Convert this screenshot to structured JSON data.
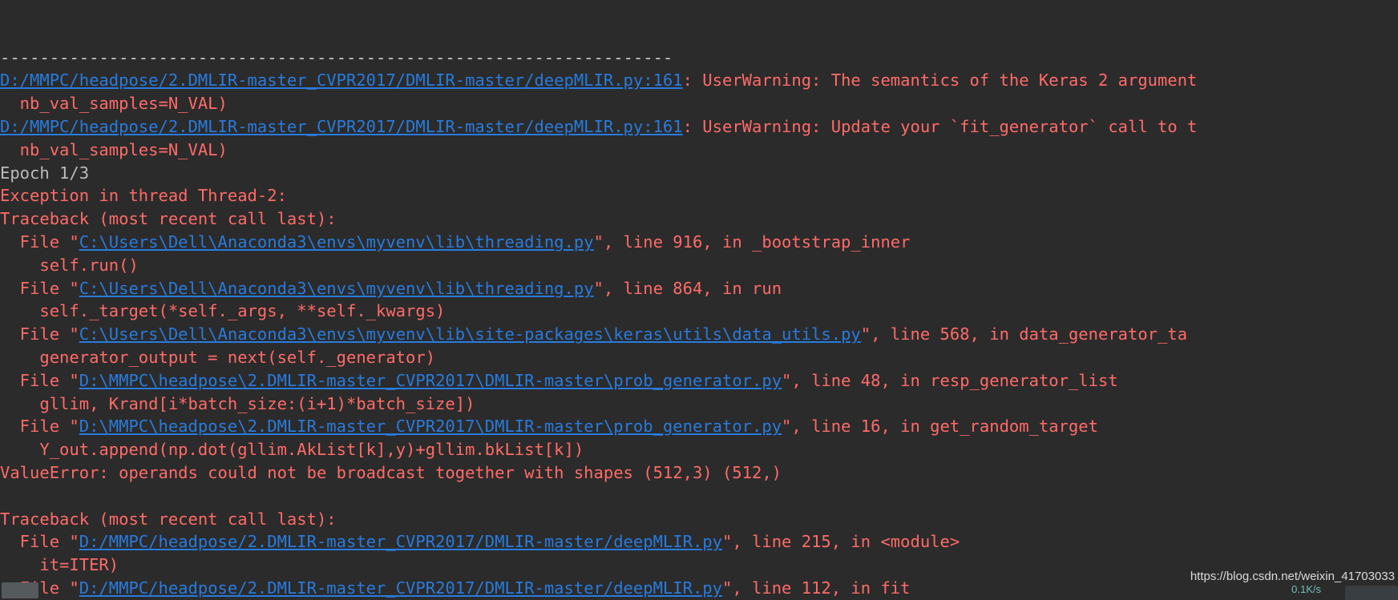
{
  "console": {
    "background_color": "#2b2b2b",
    "error_color": "#ff6b68",
    "link_color": "#287bde",
    "plain_color": "#bbbbbb",
    "lines": [
      {
        "segments": [
          {
            "text": "--------------------------------------------------------------------",
            "style": "dash"
          }
        ]
      },
      {
        "segments": [
          {
            "text": "D:/MMPC/headpose/2.DMLIR-master_CVPR2017/DMLIR-master/deepMLIR.py:161",
            "style": "link"
          },
          {
            "text": ": UserWarning: The semantics of the Keras 2 argument ",
            "style": "err"
          }
        ]
      },
      {
        "segments": [
          {
            "text": "  nb_val_samples=N_VAL)",
            "style": "err"
          }
        ]
      },
      {
        "segments": [
          {
            "text": "D:/MMPC/headpose/2.DMLIR-master_CVPR2017/DMLIR-master/deepMLIR.py:161",
            "style": "link"
          },
          {
            "text": ": UserWarning: Update your `fit_generator` call to t",
            "style": "err"
          }
        ]
      },
      {
        "segments": [
          {
            "text": "  nb_val_samples=N_VAL)",
            "style": "err"
          }
        ]
      },
      {
        "segments": [
          {
            "text": "Epoch 1/3",
            "style": "plain"
          }
        ]
      },
      {
        "segments": [
          {
            "text": "Exception in thread Thread-2:",
            "style": "err"
          }
        ]
      },
      {
        "segments": [
          {
            "text": "Traceback (most recent call last):",
            "style": "err"
          }
        ]
      },
      {
        "segments": [
          {
            "text": "  File \"",
            "style": "err"
          },
          {
            "text": "C:\\Users\\Dell\\Anaconda3\\envs\\myvenv\\lib\\threading.py",
            "style": "link"
          },
          {
            "text": "\", line 916, in _bootstrap_inner",
            "style": "err"
          }
        ]
      },
      {
        "segments": [
          {
            "text": "    self.run()",
            "style": "err"
          }
        ]
      },
      {
        "segments": [
          {
            "text": "  File \"",
            "style": "err"
          },
          {
            "text": "C:\\Users\\Dell\\Anaconda3\\envs\\myvenv\\lib\\threading.py",
            "style": "link"
          },
          {
            "text": "\", line 864, in run",
            "style": "err"
          }
        ]
      },
      {
        "segments": [
          {
            "text": "    self._target(*self._args, **self._kwargs)",
            "style": "err"
          }
        ]
      },
      {
        "segments": [
          {
            "text": "  File \"",
            "style": "err"
          },
          {
            "text": "C:\\Users\\Dell\\Anaconda3\\envs\\myvenv\\lib\\site-packages\\keras\\utils\\data_utils.py",
            "style": "link"
          },
          {
            "text": "\", line 568, in data_generator_ta",
            "style": "err"
          }
        ]
      },
      {
        "segments": [
          {
            "text": "    generator_output = next(self._generator)",
            "style": "err"
          }
        ]
      },
      {
        "segments": [
          {
            "text": "  File \"",
            "style": "err"
          },
          {
            "text": "D:\\MMPC\\headpose\\2.DMLIR-master_CVPR2017\\DMLIR-master\\prob_generator.py",
            "style": "link"
          },
          {
            "text": "\", line 48, in resp_generator_list",
            "style": "err"
          }
        ]
      },
      {
        "segments": [
          {
            "text": "    gllim, Krand[i*batch_size:(i+1)*batch_size])",
            "style": "err"
          }
        ]
      },
      {
        "segments": [
          {
            "text": "  File \"",
            "style": "err"
          },
          {
            "text": "D:\\MMPC\\headpose\\2.DMLIR-master_CVPR2017\\DMLIR-master\\prob_generator.py",
            "style": "link"
          },
          {
            "text": "\", line 16, in get_random_target",
            "style": "err"
          }
        ]
      },
      {
        "segments": [
          {
            "text": "    Y_out.append(np.dot(gllim.AkList[k],y)+gllim.bkList[k])",
            "style": "err"
          }
        ]
      },
      {
        "segments": [
          {
            "text": "ValueError: operands could not be broadcast together with shapes (512,3) (512,)",
            "style": "err"
          }
        ]
      },
      {
        "segments": [
          {
            "text": "",
            "style": "err"
          }
        ]
      },
      {
        "segments": [
          {
            "text": "Traceback (most recent call last):",
            "style": "err"
          }
        ]
      },
      {
        "segments": [
          {
            "text": "  File \"",
            "style": "err"
          },
          {
            "text": "D:/MMPC/headpose/2.DMLIR-master_CVPR2017/DMLIR-master/deepMLIR.py",
            "style": "link"
          },
          {
            "text": "\", line 215, in <module>",
            "style": "err"
          }
        ]
      },
      {
        "segments": [
          {
            "text": "    it=ITER)",
            "style": "err"
          }
        ]
      },
      {
        "segments": [
          {
            "text": "  File \"",
            "style": "err"
          },
          {
            "text": "D:/MMPC/headpose/2.DMLIR-master_CVPR2017/DMLIR-master/deepMLIR.py",
            "style": "link"
          },
          {
            "text": "\", line 112, in fit",
            "style": "err"
          }
        ]
      }
    ]
  },
  "watermark": {
    "url": "https://blog.csdn.net/weixin_41703033",
    "network_speed": "0.1K/s"
  }
}
